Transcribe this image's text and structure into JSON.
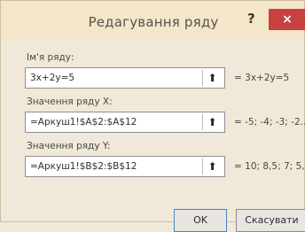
{
  "window": {
    "title": "Редагування ряду",
    "help": "?",
    "close": "×"
  },
  "series": {
    "name_label": "Ім'я ряду:",
    "name_value": "3x+2y=5",
    "name_result": "= 3x+2y=5",
    "x_label": "Значення ряду X:",
    "x_value": "=Аркуш1!$A$2:$A$12",
    "x_result": "= -5; -4; -3; -2...",
    "y_label": "Значення ряду Y:",
    "y_value": "=Аркуш1!$B$2:$B$12",
    "y_result": "= 10; 8,5; 7; 5,..."
  },
  "buttons": {
    "ok": "OK",
    "cancel": "Скасувати"
  },
  "icons": {
    "collapse": "collapse-dialog-icon"
  }
}
